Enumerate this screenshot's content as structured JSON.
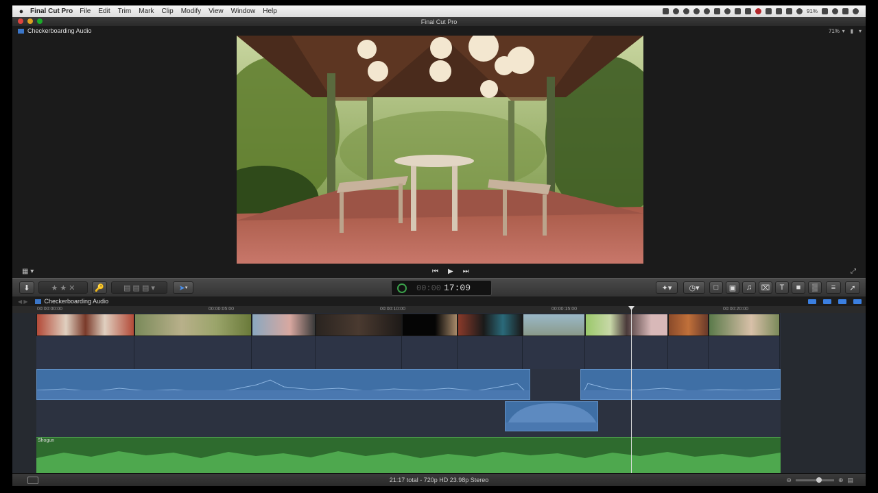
{
  "menubar": {
    "app_name": "Final Cut Pro",
    "items": [
      "File",
      "Edit",
      "Trim",
      "Mark",
      "Clip",
      "Modify",
      "View",
      "Window",
      "Help"
    ],
    "battery": "91%"
  },
  "window": {
    "title": "Final Cut Pro"
  },
  "viewer": {
    "project_name": "Checkerboarding Audio",
    "zoom": "71%"
  },
  "toolbar": {
    "timecode_dim": "00:00",
    "timecode": "17:09"
  },
  "timeline": {
    "project_name": "Checkerboarding Audio",
    "ruler": [
      "00:00:00:00",
      "00:00:05:00",
      "00:00:10:00",
      "00:00:15:00",
      "00:00:20:00"
    ],
    "music_label": "Shogun",
    "colors": {
      "audio": "#3f6fa5",
      "music": "#2e6b2e",
      "accent": "#3b7fe0"
    }
  },
  "status": {
    "summary": "21:17 total - 720p HD 23.98p Stereo"
  }
}
